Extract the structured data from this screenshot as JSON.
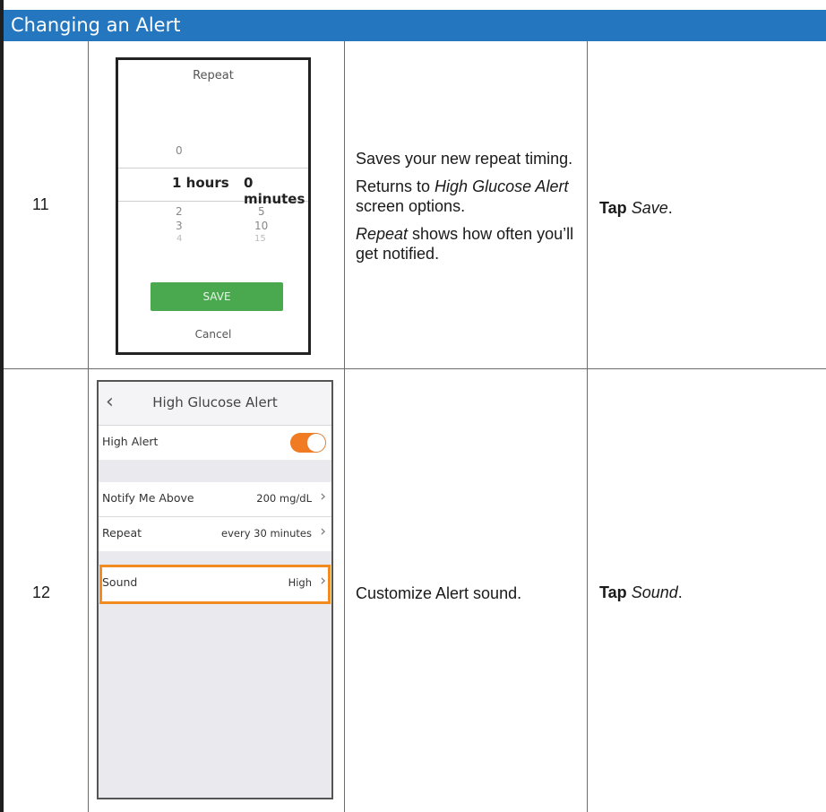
{
  "header": {
    "title": "Changing an Alert"
  },
  "steps": [
    {
      "number": "11",
      "screen": {
        "title": "Repeat",
        "picker_above": "0",
        "selected_hours": "1",
        "hours_label": "hours",
        "selected_minutes": "0",
        "minutes_label": "minutes",
        "hours_below": [
          "2",
          "3",
          "4"
        ],
        "minutes_below": [
          "5",
          "10",
          "15"
        ],
        "save_label": "SAVE",
        "cancel_label": "Cancel",
        "save_color": "#4aa94f"
      },
      "description": {
        "p1": "Saves your new repeat timing.",
        "p2_pre": "Returns to ",
        "p2_italic": "High Glucose Alert",
        "p2_post": " screen options.",
        "p3_italic": "Repeat",
        "p3_post": " shows how often you’ll get notified."
      },
      "action": {
        "verb": "Tap",
        "target": "Save",
        "suffix": "."
      }
    },
    {
      "number": "12",
      "screen": {
        "back_icon": "chevron-left-icon",
        "title": "High Glucose Alert",
        "high_alert_label": "High Alert",
        "high_alert_on": true,
        "toggle_color": "#f07b22",
        "notify_label": "Notify Me Above",
        "notify_value": "200 mg/dL",
        "repeat_label": "Repeat",
        "repeat_value": "every 30 minutes",
        "sound_label": "Sound",
        "sound_value": "High",
        "highlight_color": "#f28c1e"
      },
      "description": {
        "p1": "Customize Alert sound."
      },
      "action": {
        "verb": "Tap",
        "target": "Sound",
        "suffix": "."
      }
    }
  ],
  "colors": {
    "header_bg": "#2476bf"
  }
}
